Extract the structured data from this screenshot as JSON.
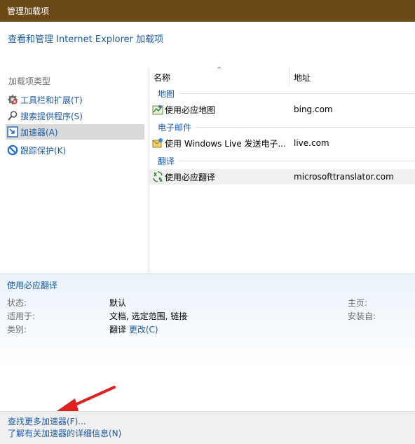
{
  "window": {
    "title": "管理加载项"
  },
  "header": {
    "link": "查看和管理 Internet Explorer 加载项"
  },
  "sidebar": {
    "label": "加载项类型",
    "items": [
      {
        "label": "工具栏和扩展(T)",
        "icon": "gear-icon"
      },
      {
        "label": "搜索提供程序(S)",
        "icon": "search-icon"
      },
      {
        "label": "加速器(A)",
        "icon": "accelerator-icon",
        "selected": true
      },
      {
        "label": "跟踪保护(K)",
        "icon": "tracking-protection-icon"
      }
    ]
  },
  "list": {
    "columns": {
      "name": "名称",
      "address": "地址"
    },
    "groups": [
      {
        "label": "地图",
        "rows": [
          {
            "name": "使用必应地图",
            "address": "bing.com",
            "icon": "map-icon"
          }
        ]
      },
      {
        "label": "电子邮件",
        "rows": [
          {
            "name": "使用 Windows Live 发送电子...",
            "address": "live.com",
            "icon": "mail-icon"
          }
        ]
      },
      {
        "label": "翻译",
        "rows": [
          {
            "name": "使用必应翻译",
            "address": "microsofttranslator.com",
            "icon": "translate-icon",
            "selected": true
          }
        ]
      }
    ]
  },
  "details": {
    "title": "使用必应翻译",
    "status_label": "状态:",
    "status_value": "默认",
    "applies_label": "适用于:",
    "applies_value": "文档, 选定范围, 链接",
    "category_label": "类别:",
    "category_value": "翻译",
    "change_link": "更改(C)",
    "home_label": "主页:",
    "install_label": "安装自:"
  },
  "footer": {
    "find_more": "查找更多加速器(F)...",
    "learn_more": "了解有关加速器的详细信息(N)"
  },
  "colors": {
    "titlebar": "#6b4a18",
    "link": "#1a5ba8",
    "annotation_arrow": "#e02020"
  }
}
